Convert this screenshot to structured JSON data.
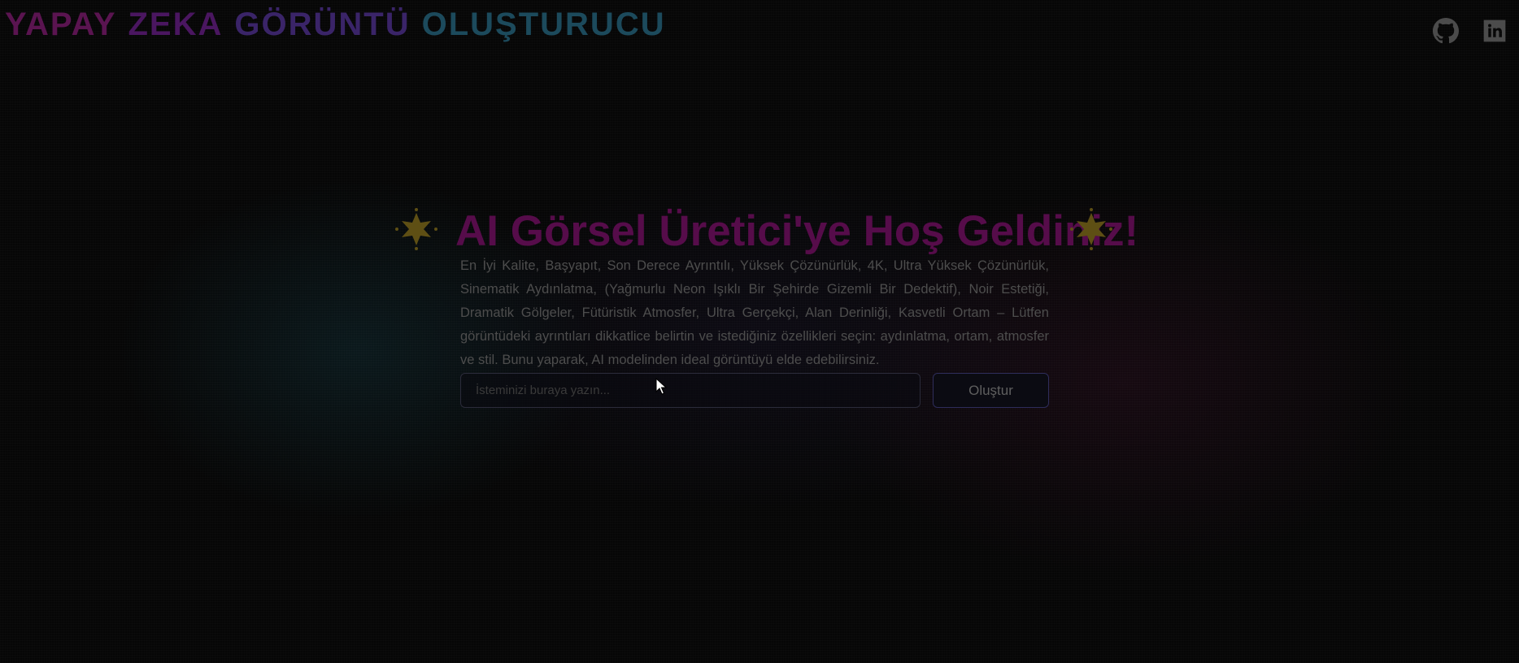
{
  "header": {
    "brand_words": [
      "YAPAY",
      "ZEKA",
      "GÖRÜNTÜ",
      "OLUŞTURUCU"
    ],
    "links": [
      {
        "icon": "github-icon"
      },
      {
        "icon": "linkedin-icon"
      }
    ]
  },
  "hero": {
    "title": "AI Görsel Üretici'ye Hoş Geldiniz!",
    "sparkle_icon": "sparkle-star-icon",
    "sparkle_color": "#6b5a16",
    "description": "En İyi Kalite, Başyapıt, Son Derece Ayrıntılı, Yüksek Çözünürlük, 4K, Ultra Yüksek Çözünürlük, Sinematik Aydınlatma, (Yağmurlu Neon Işıklı Bir Şehirde Gizemli Bir Dedektif), Noir Estetiği, Dramatik Gölgeler, Fütüristik Atmosfer, Ultra Gerçekçi, Alan Derinliği, Kasvetli Ortam – Lütfen görüntüdeki ayrıntıları dikkatlice belirtin ve istediğiniz özellikleri seçin: aydınlatma, ortam, atmosfer ve stil. Bunu yaparak, AI modelinden ideal görüntüyü elde edebilirsiniz."
  },
  "form": {
    "prompt_placeholder": "İsteminizi buraya yazın...",
    "prompt_value": "",
    "submit_label": "Oluştur"
  },
  "colors": {
    "background": "#060606",
    "title": "#560c4a",
    "brand_gradient": [
      "#5a1450",
      "#4a1660",
      "#3a2468",
      "#1c4a5c"
    ],
    "button_border": "#2e2c5a"
  }
}
